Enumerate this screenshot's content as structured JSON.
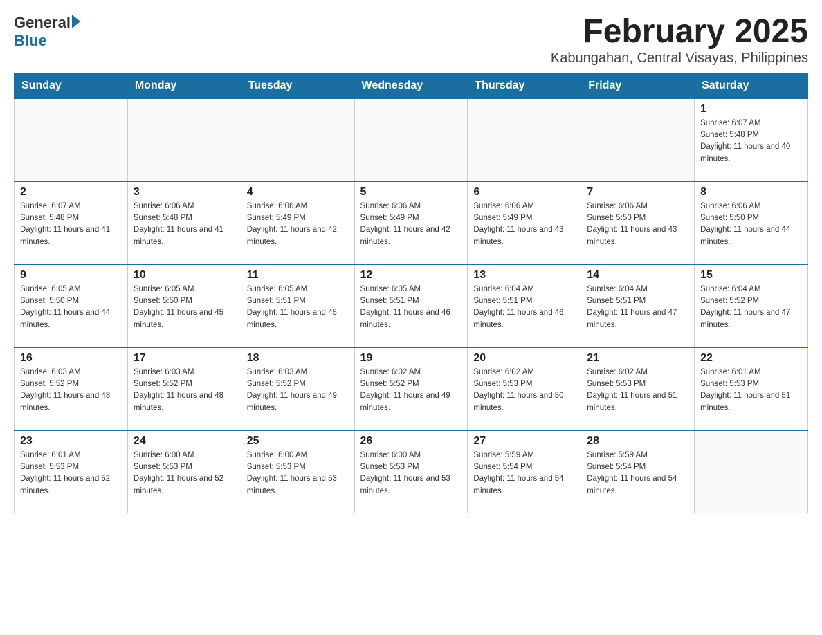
{
  "header": {
    "logo_general": "General",
    "logo_blue": "Blue",
    "title": "February 2025",
    "subtitle": "Kabungahan, Central Visayas, Philippines"
  },
  "days_of_week": [
    "Sunday",
    "Monday",
    "Tuesday",
    "Wednesday",
    "Thursday",
    "Friday",
    "Saturday"
  ],
  "weeks": [
    [
      {
        "day": "",
        "info": ""
      },
      {
        "day": "",
        "info": ""
      },
      {
        "day": "",
        "info": ""
      },
      {
        "day": "",
        "info": ""
      },
      {
        "day": "",
        "info": ""
      },
      {
        "day": "",
        "info": ""
      },
      {
        "day": "1",
        "info": "Sunrise: 6:07 AM\nSunset: 5:48 PM\nDaylight: 11 hours and 40 minutes."
      }
    ],
    [
      {
        "day": "2",
        "info": "Sunrise: 6:07 AM\nSunset: 5:48 PM\nDaylight: 11 hours and 41 minutes."
      },
      {
        "day": "3",
        "info": "Sunrise: 6:06 AM\nSunset: 5:48 PM\nDaylight: 11 hours and 41 minutes."
      },
      {
        "day": "4",
        "info": "Sunrise: 6:06 AM\nSunset: 5:49 PM\nDaylight: 11 hours and 42 minutes."
      },
      {
        "day": "5",
        "info": "Sunrise: 6:06 AM\nSunset: 5:49 PM\nDaylight: 11 hours and 42 minutes."
      },
      {
        "day": "6",
        "info": "Sunrise: 6:06 AM\nSunset: 5:49 PM\nDaylight: 11 hours and 43 minutes."
      },
      {
        "day": "7",
        "info": "Sunrise: 6:06 AM\nSunset: 5:50 PM\nDaylight: 11 hours and 43 minutes."
      },
      {
        "day": "8",
        "info": "Sunrise: 6:06 AM\nSunset: 5:50 PM\nDaylight: 11 hours and 44 minutes."
      }
    ],
    [
      {
        "day": "9",
        "info": "Sunrise: 6:05 AM\nSunset: 5:50 PM\nDaylight: 11 hours and 44 minutes."
      },
      {
        "day": "10",
        "info": "Sunrise: 6:05 AM\nSunset: 5:50 PM\nDaylight: 11 hours and 45 minutes."
      },
      {
        "day": "11",
        "info": "Sunrise: 6:05 AM\nSunset: 5:51 PM\nDaylight: 11 hours and 45 minutes."
      },
      {
        "day": "12",
        "info": "Sunrise: 6:05 AM\nSunset: 5:51 PM\nDaylight: 11 hours and 46 minutes."
      },
      {
        "day": "13",
        "info": "Sunrise: 6:04 AM\nSunset: 5:51 PM\nDaylight: 11 hours and 46 minutes."
      },
      {
        "day": "14",
        "info": "Sunrise: 6:04 AM\nSunset: 5:51 PM\nDaylight: 11 hours and 47 minutes."
      },
      {
        "day": "15",
        "info": "Sunrise: 6:04 AM\nSunset: 5:52 PM\nDaylight: 11 hours and 47 minutes."
      }
    ],
    [
      {
        "day": "16",
        "info": "Sunrise: 6:03 AM\nSunset: 5:52 PM\nDaylight: 11 hours and 48 minutes."
      },
      {
        "day": "17",
        "info": "Sunrise: 6:03 AM\nSunset: 5:52 PM\nDaylight: 11 hours and 48 minutes."
      },
      {
        "day": "18",
        "info": "Sunrise: 6:03 AM\nSunset: 5:52 PM\nDaylight: 11 hours and 49 minutes."
      },
      {
        "day": "19",
        "info": "Sunrise: 6:02 AM\nSunset: 5:52 PM\nDaylight: 11 hours and 49 minutes."
      },
      {
        "day": "20",
        "info": "Sunrise: 6:02 AM\nSunset: 5:53 PM\nDaylight: 11 hours and 50 minutes."
      },
      {
        "day": "21",
        "info": "Sunrise: 6:02 AM\nSunset: 5:53 PM\nDaylight: 11 hours and 51 minutes."
      },
      {
        "day": "22",
        "info": "Sunrise: 6:01 AM\nSunset: 5:53 PM\nDaylight: 11 hours and 51 minutes."
      }
    ],
    [
      {
        "day": "23",
        "info": "Sunrise: 6:01 AM\nSunset: 5:53 PM\nDaylight: 11 hours and 52 minutes."
      },
      {
        "day": "24",
        "info": "Sunrise: 6:00 AM\nSunset: 5:53 PM\nDaylight: 11 hours and 52 minutes."
      },
      {
        "day": "25",
        "info": "Sunrise: 6:00 AM\nSunset: 5:53 PM\nDaylight: 11 hours and 53 minutes."
      },
      {
        "day": "26",
        "info": "Sunrise: 6:00 AM\nSunset: 5:53 PM\nDaylight: 11 hours and 53 minutes."
      },
      {
        "day": "27",
        "info": "Sunrise: 5:59 AM\nSunset: 5:54 PM\nDaylight: 11 hours and 54 minutes."
      },
      {
        "day": "28",
        "info": "Sunrise: 5:59 AM\nSunset: 5:54 PM\nDaylight: 11 hours and 54 minutes."
      },
      {
        "day": "",
        "info": ""
      }
    ]
  ]
}
